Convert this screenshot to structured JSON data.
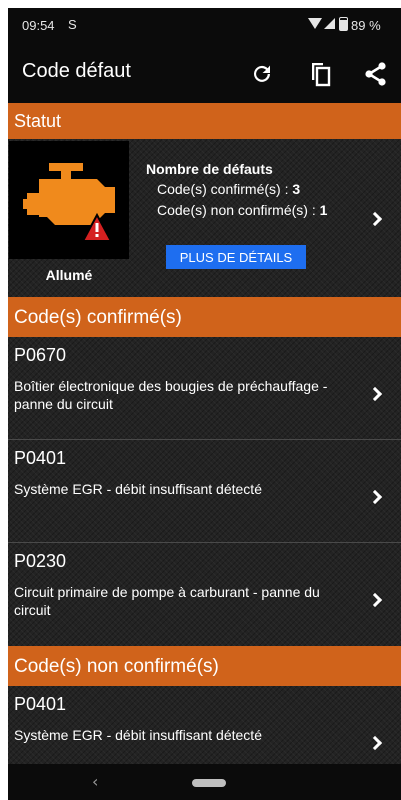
{
  "status_bar": {
    "time": "09:54",
    "sim_icon": "S",
    "battery": "89 %"
  },
  "app_bar": {
    "title": "Code défaut",
    "actions": [
      "refresh-icon",
      "copy-icon",
      "share-icon"
    ]
  },
  "status_section": {
    "header": "Statut",
    "engine_icon": "check-engine-warning-icon",
    "engine_state": "Allumé",
    "count_title": "Nombre de défauts",
    "confirmed_label": "Code(s) confirmé(s) :",
    "confirmed_count": "3",
    "unconfirmed_label": "Code(s) non confirmé(s) :",
    "unconfirmed_count": "1",
    "details_button": "PLUS DE DÉTAILS"
  },
  "confirmed_section": {
    "header": "Code(s) confirmé(s)",
    "codes": [
      {
        "code": "P0670",
        "description": "Boîtier électronique des bougies de préchauffage - panne du circuit"
      },
      {
        "code": "P0401",
        "description": "Système EGR - débit insuffisant détecté"
      },
      {
        "code": "P0230",
        "description": "Circuit primaire de pompe à carburant - panne du circuit"
      }
    ]
  },
  "unconfirmed_section": {
    "header": "Code(s) non confirmé(s)",
    "codes": [
      {
        "code": "P0401",
        "description": "Système EGR - débit insuffisant détecté"
      }
    ]
  },
  "nav_bar": {
    "back_glyph": "‹"
  },
  "colors": {
    "accent": "#d0631b",
    "button": "#1e6ef0",
    "engine_orange": "#f08a1c",
    "warning_red": "#d42020"
  }
}
